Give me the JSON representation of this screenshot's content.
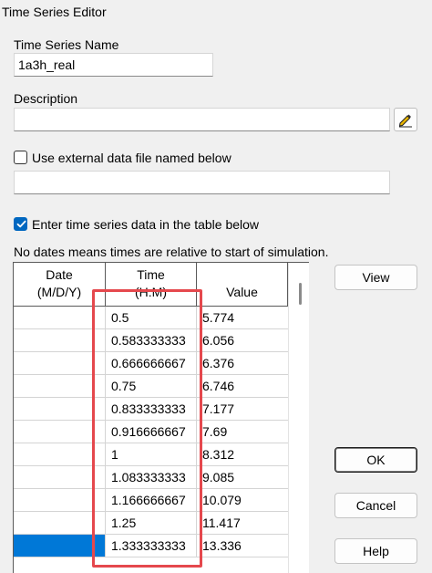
{
  "window": {
    "title": "Time Series Editor"
  },
  "name_section": {
    "label": "Time Series Name",
    "value": "1a3h_real"
  },
  "description_section": {
    "label": "Description",
    "value": "",
    "edit_icon": "pencil-icon"
  },
  "external_file": {
    "checked": false,
    "label": "Use external data file named below",
    "path": ""
  },
  "table_option": {
    "checked": true,
    "label": "Enter time series data in the table below"
  },
  "note": "No dates means times are relative to start of simulation.",
  "table": {
    "columns": [
      {
        "line1": "Date",
        "line2": "(M/D/Y)"
      },
      {
        "line1": "Time",
        "line2": "(H:M)"
      },
      {
        "line1": "Value",
        "line2": ""
      }
    ],
    "rows": [
      {
        "date": "",
        "time": "0.5",
        "value": "5.774"
      },
      {
        "date": "",
        "time": "0.583333333",
        "value": "6.056"
      },
      {
        "date": "",
        "time": "0.666666667",
        "value": "6.376"
      },
      {
        "date": "",
        "time": "0.75",
        "value": "6.746"
      },
      {
        "date": "",
        "time": "0.833333333",
        "value": "7.177"
      },
      {
        "date": "",
        "time": "0.916666667",
        "value": "7.69"
      },
      {
        "date": "",
        "time": "1",
        "value": "8.312"
      },
      {
        "date": "",
        "time": "1.083333333",
        "value": "9.085"
      },
      {
        "date": "",
        "time": "1.166666667",
        "value": "10.079"
      },
      {
        "date": "",
        "time": "1.25",
        "value": "11.417"
      },
      {
        "date": "",
        "time": "1.333333333",
        "value": "13.336"
      }
    ],
    "selected_row": 10
  },
  "buttons": {
    "view": "View",
    "ok": "OK",
    "cancel": "Cancel",
    "help": "Help"
  },
  "colors": {
    "selection": "#0078d7",
    "highlight": "#e5484d",
    "checkbox": "#0067c0"
  }
}
